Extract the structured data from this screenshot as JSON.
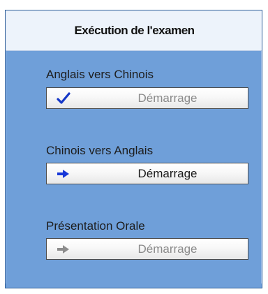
{
  "panel": {
    "title": "Exécution de l'examen"
  },
  "sections": [
    {
      "label": "Anglais vers Chinois",
      "button_label": "Démarrage",
      "icon": "check-icon",
      "state": "disabled"
    },
    {
      "label": "Chinois vers Anglais",
      "button_label": "Démarrage",
      "icon": "arrow-right-icon",
      "state": "active"
    },
    {
      "label": "Présentation Orale",
      "button_label": "Démarrage",
      "icon": "arrow-right-icon",
      "state": "disabled"
    }
  ],
  "colors": {
    "panel_bg": "#6f9fd9",
    "header_bg": "#edf3fb",
    "check_icon": "#1638c7",
    "arrow_active": "#1737d8",
    "arrow_disabled": "#8c8c8c"
  }
}
